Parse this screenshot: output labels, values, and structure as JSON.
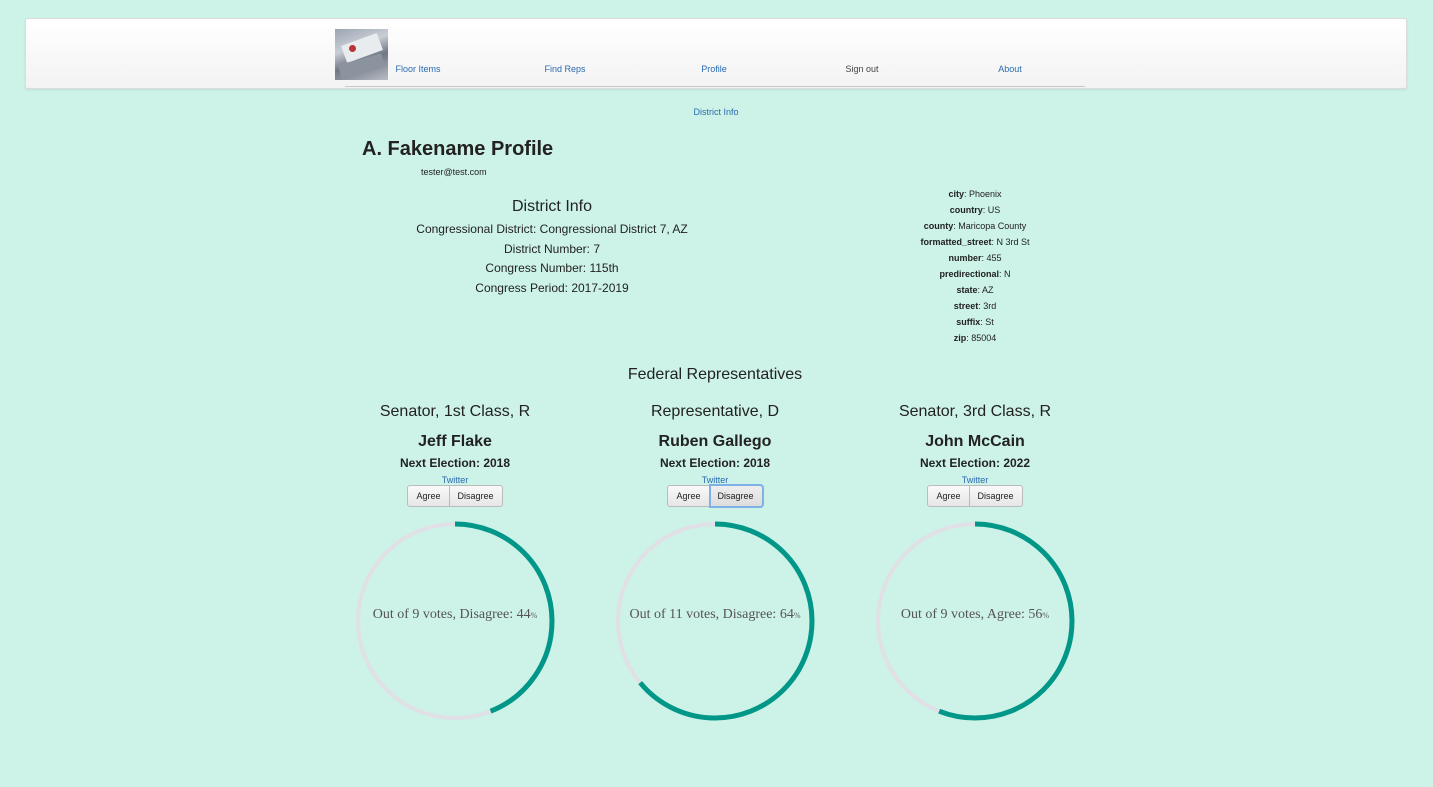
{
  "nav": {
    "items": [
      {
        "label": "Floor Items",
        "style": "link"
      },
      {
        "label": "Find Reps",
        "style": "link"
      },
      {
        "label": "Profile",
        "style": "link"
      },
      {
        "label": "Sign out",
        "style": "plain"
      },
      {
        "label": "About",
        "style": "link"
      }
    ],
    "subnav": "District Info"
  },
  "profile": {
    "title": "A. Fakename Profile",
    "email": "tester@test.com"
  },
  "district": {
    "heading": "District Info",
    "lines": [
      "Congressional District: Congressional District 7, AZ",
      "District Number: 7",
      "Congress Number: 115th",
      "Congress Period: 2017-2019"
    ]
  },
  "address": [
    {
      "key": "city",
      "value": "Phoenix"
    },
    {
      "key": "country",
      "value": "US"
    },
    {
      "key": "county",
      "value": "Maricopa County"
    },
    {
      "key": "formatted_street",
      "value": "N 3rd St"
    },
    {
      "key": "number",
      "value": "455"
    },
    {
      "key": "predirectional",
      "value": "N"
    },
    {
      "key": "state",
      "value": "AZ"
    },
    {
      "key": "street",
      "value": "3rd"
    },
    {
      "key": "suffix",
      "value": "St"
    },
    {
      "key": "zip",
      "value": "85004"
    }
  ],
  "federal": {
    "heading": "Federal Representatives",
    "reps": [
      {
        "office": "Senator, 1st Class, R",
        "name": "Jeff Flake",
        "next_election": "Next Election: 2018",
        "twitter": "Twitter",
        "agree_label": "Agree",
        "disagree_label": "Disagree",
        "focused": "none",
        "gauge_text": "Out of 9 votes, Disagree: 44",
        "gauge_unit": "%",
        "fill_fraction": 0.44
      },
      {
        "office": "Representative, D",
        "name": "Ruben Gallego",
        "next_election": "Next Election: 2018",
        "twitter": "Twitter",
        "agree_label": "Agree",
        "disagree_label": "Disagree",
        "focused": "disagree",
        "gauge_text": "Out of 11 votes, Disagree: 64",
        "gauge_unit": "%",
        "fill_fraction": 0.64
      },
      {
        "office": "Senator, 3rd Class, R",
        "name": "John McCain",
        "next_election": "Next Election: 2022",
        "twitter": "Twitter",
        "agree_label": "Agree",
        "disagree_label": "Disagree",
        "focused": "none",
        "gauge_text": "Out of 9 votes, Agree: 56",
        "gauge_unit": "%",
        "fill_fraction": 0.56
      }
    ]
  },
  "colors": {
    "background": "#cdf2e7",
    "gauge_fill": "#009688",
    "gauge_track": "#e0e0e6",
    "link": "#2a6ab0"
  }
}
